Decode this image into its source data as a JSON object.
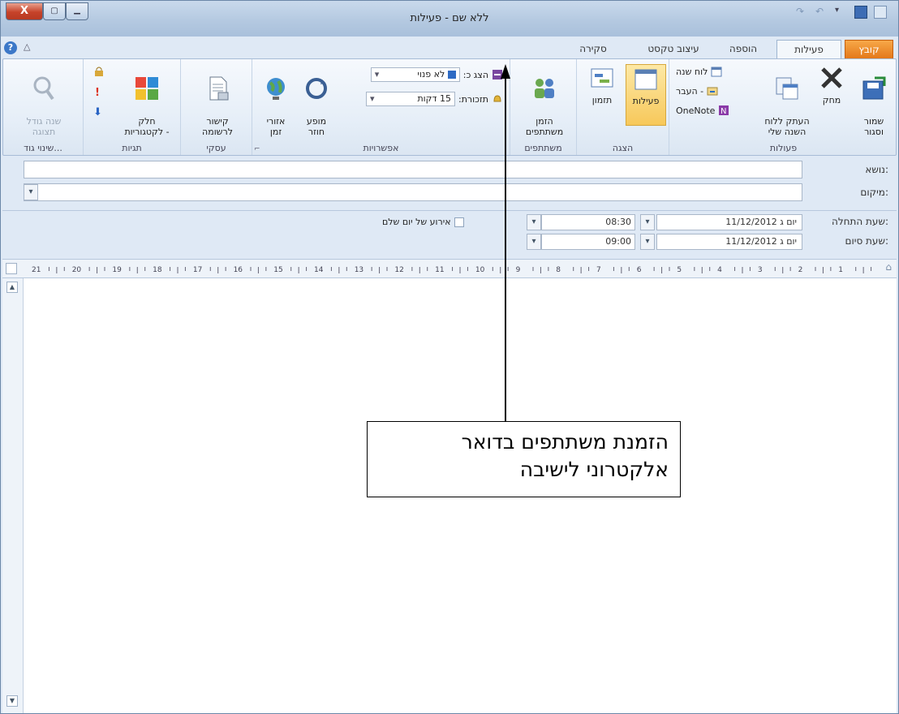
{
  "window": {
    "title": "ללא שם - פעילות",
    "close_label": "X"
  },
  "tabs": {
    "file": "קובץ",
    "activity": "פעילות",
    "insert": "הוספה",
    "format": "עיצוב טקסט",
    "review": "סקירה"
  },
  "ribbon": {
    "actions": {
      "save_close": "שמור\nוסגור",
      "delete": "מחק",
      "copy_to_calendar": "העתק ללוח\nהשנה שלי",
      "calendar": "לוח שנה",
      "move": "העבר -",
      "onenote": "OneNote",
      "group": "פעולות"
    },
    "view": {
      "activity": "פעילות",
      "scheduling": "תזמון",
      "group": "הצגה"
    },
    "participants": {
      "invite": "הזמן\nמשתתפים",
      "group": "משתתפים"
    },
    "options": {
      "show_as_label": "הצג כ:",
      "show_as_value": "לא פנוי",
      "reminder_label": "תזכורת:",
      "reminder_value": "15 דקות",
      "recurrence": "מופע\nחוזר",
      "time_zones": "אזורי\nזמן",
      "group": "אפשרויות"
    },
    "business": {
      "link_to_record": "קישור\nלרשומה",
      "group": "עסקי"
    },
    "tags": {
      "categorize": "חלק\nלקטגוריות -",
      "group": "תגיות"
    },
    "zoom": {
      "zoom": "שנה גודל\nתצוגה",
      "group": "שינוי גוד..."
    }
  },
  "form": {
    "subject_label": "נושא:",
    "subject_value": "",
    "location_label": "מיקום:",
    "location_value": "",
    "start_label": "שעת התחלה:",
    "start_date": "יום ג 11/12/2012",
    "start_time": "08:30",
    "end_label": "שעת סיום:",
    "end_date": "יום ג 11/12/2012",
    "end_time": "09:00",
    "all_day": "אירוע של יום שלם"
  },
  "ruler": {
    "ticks": [
      "21",
      "20",
      "19",
      "18",
      "17",
      "16",
      "15",
      "14",
      "13",
      "12",
      "11",
      "10",
      "9",
      "8",
      "7",
      "6",
      "5",
      "4",
      "3",
      "2",
      "1"
    ]
  },
  "callout": {
    "text": "הזמנת משתתפים בדואר אלקטרוני לישיבה"
  },
  "colors": {
    "file_tab": "#e4781a",
    "ribbon_bg": "#e4edf7",
    "close_button": "#c6432a"
  }
}
